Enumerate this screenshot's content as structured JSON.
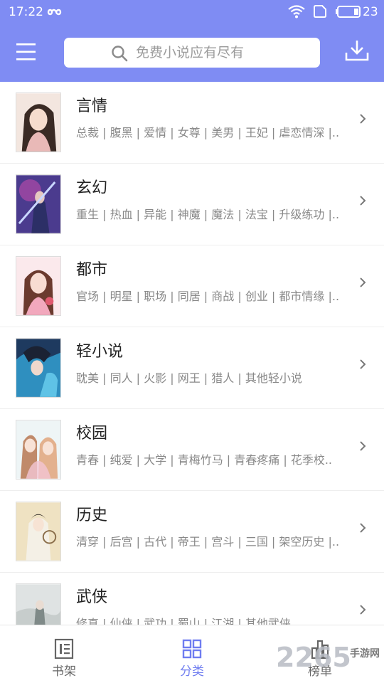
{
  "status_bar": {
    "time": "17:22",
    "battery_level": "23",
    "icons": [
      "infinity-icon",
      "wifi-icon",
      "sim-icon",
      "battery-icon"
    ]
  },
  "header": {
    "background_color": "#7f8cf3",
    "search_placeholder": "免费小说应有尽有",
    "icons": [
      "menu-icon",
      "search-icon",
      "download-icon"
    ]
  },
  "categories": [
    {
      "title": "言情",
      "tags": "总裁 | 腹黑 | 爱情 | 女尊 | 美男 | 王妃 | 虐恋情深 |.."
    },
    {
      "title": "玄幻",
      "tags": "重生 | 热血 | 异能 | 神魔 | 魔法 | 法宝 | 升级练功 |.."
    },
    {
      "title": "都市",
      "tags": "官场 | 明星 | 职场 | 同居 | 商战 | 创业 | 都市情缘 |.."
    },
    {
      "title": "轻小说",
      "tags": "耽美 | 同人 | 火影 | 网王 | 猎人 | 其他轻小说"
    },
    {
      "title": "校园",
      "tags": "青春 | 纯爱 | 大学 | 青梅竹马 | 青春疼痛 | 花季校.."
    },
    {
      "title": "历史",
      "tags": "清穿 | 后宫 | 古代 | 帝王 | 宫斗 | 三国 | 架空历史 |.."
    },
    {
      "title": "武侠",
      "tags": "修真 | 仙侠 | 武功 | 蜀山 | 江湖 | 其他武侠"
    }
  ],
  "tabs": [
    {
      "label": "书架",
      "icon": "bookshelf-icon",
      "active": false
    },
    {
      "label": "分类",
      "icon": "category-icon",
      "active": true
    },
    {
      "label": "榜单",
      "icon": "ranking-icon",
      "active": false
    }
  ],
  "watermark": {
    "number": "2265",
    "text": "手游网"
  },
  "colors": {
    "accent": "#7f8cf3",
    "active_tab": "#6f7df0",
    "tag_text": "#888888"
  }
}
